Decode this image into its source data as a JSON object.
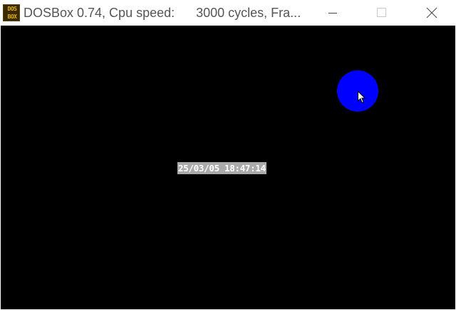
{
  "window": {
    "title": "DOSBox 0.74, Cpu speed:      3000 cycles, Fra...",
    "icon": {
      "name": "dosbox-icon",
      "text_top": "DOS",
      "text_bottom": "BOX"
    },
    "controls": [
      "minimize-icon",
      "maximize-icon",
      "close-icon"
    ]
  },
  "screen": {
    "background": "#000000",
    "datetime_text": "25/03/05 18:47:14",
    "ball_color": "#0000ff",
    "clock_background": "#aaaaaa"
  }
}
